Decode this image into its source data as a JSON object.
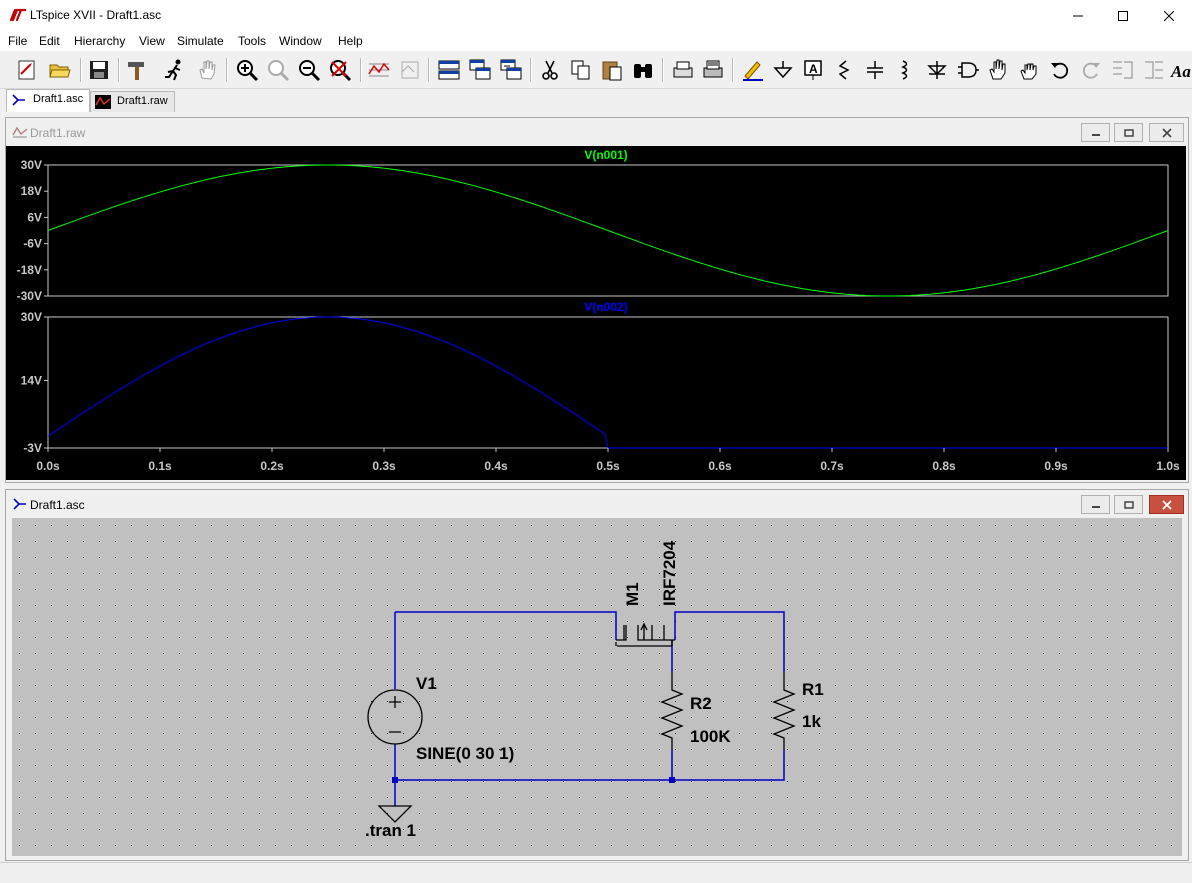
{
  "window": {
    "title": "LTspice XVII - Draft1.asc"
  },
  "menu": [
    "File",
    "Edit",
    "Hierarchy",
    "View",
    "Simulate",
    "Tools",
    "Window",
    "Help"
  ],
  "tabs": [
    {
      "label": "Draft1.asc",
      "active": true
    },
    {
      "label": "Draft1.raw",
      "active": false
    }
  ],
  "waveform_window": {
    "title": "Draft1.raw",
    "pane1": {
      "trace": "V(n001)",
      "color": "#00ff00",
      "yticks": [
        "30V",
        "18V",
        "6V",
        "-6V",
        "-18V",
        "-30V"
      ]
    },
    "pane2": {
      "trace": "V(n002)",
      "color": "#0000ff",
      "yticks": [
        "30V",
        "14V",
        "-3V"
      ]
    },
    "xticks": [
      "0.0s",
      "0.1s",
      "0.2s",
      "0.3s",
      "0.4s",
      "0.5s",
      "0.6s",
      "0.7s",
      "0.8s",
      "0.9s",
      "1.0s"
    ]
  },
  "chart_data": [
    {
      "type": "line",
      "series": [
        {
          "name": "V(n001)",
          "function": "30*sin(2*pi*t)"
        }
      ],
      "x": [
        0,
        0.05,
        0.1,
        0.15,
        0.2,
        0.25,
        0.3,
        0.35,
        0.4,
        0.45,
        0.5,
        0.55,
        0.6,
        0.65,
        0.7,
        0.75,
        0.8,
        0.85,
        0.9,
        0.95,
        1.0
      ],
      "values": [
        0,
        9.27,
        17.63,
        24.27,
        28.53,
        30,
        28.53,
        24.27,
        17.63,
        9.27,
        0,
        -9.27,
        -17.63,
        -24.27,
        -28.53,
        -30,
        -28.53,
        -24.27,
        -17.63,
        -9.27,
        0
      ],
      "xlim": [
        0,
        1.0
      ],
      "ylim": [
        -30,
        30
      ],
      "background": "#000000",
      "grid_color": "#c0c0c0"
    },
    {
      "type": "line",
      "series": [
        {
          "name": "V(n002)"
        }
      ],
      "x": [
        0,
        0.05,
        0.1,
        0.15,
        0.2,
        0.25,
        0.3,
        0.35,
        0.4,
        0.45,
        0.5,
        0.55,
        0.6,
        0.65,
        0.7,
        0.75,
        0.8,
        0.85,
        0.9,
        0.95,
        1.0
      ],
      "values": [
        -3,
        9.27,
        17.63,
        24.27,
        28.53,
        30,
        28.53,
        24.27,
        17.63,
        9.27,
        -3,
        -3,
        -3,
        -3,
        -3,
        -3,
        -3,
        -3,
        -3,
        -3,
        -3
      ],
      "xlim": [
        0,
        1.0
      ],
      "ylim": [
        -3,
        30
      ],
      "background": "#000000"
    }
  ],
  "schematic_window": {
    "title": "Draft1.asc",
    "components": {
      "mosfet_name": "M1",
      "mosfet_model": "IRF7204",
      "source_name": "V1",
      "source_value": "SINE(0 30 1)",
      "r2_name": "R2",
      "r2_value": "100K",
      "r1_name": "R1",
      "r1_value": "1k",
      "directive": ".tran 1"
    },
    "wire_color": "#0000c0",
    "background": "#c0c0c0"
  }
}
